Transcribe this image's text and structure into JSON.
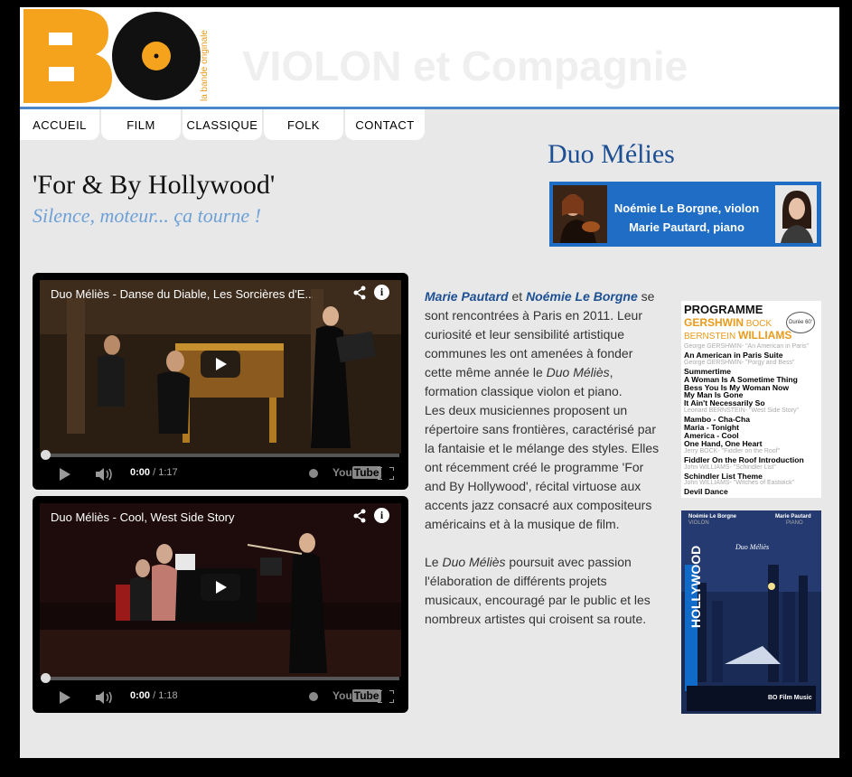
{
  "logo": {
    "tagline": "la bande originale"
  },
  "site_title": "VIOLON et Compagnie",
  "nav": [
    "ACCUEIL",
    "FILM",
    "CLASSIQUE",
    "FOLK",
    "CONTACT"
  ],
  "heading": "'For & By Hollywood'",
  "subheading": "Silence, moteur... ça tourne !",
  "duo": {
    "title": "Duo Mélies",
    "line1": "Noémie Le Borgne, violon",
    "line2": "Marie Pautard, piano"
  },
  "videos": [
    {
      "title": "Duo Méliès - Danse du Diable, Les Sorcières d'E...",
      "time_current": "0:00",
      "time_total": "/ 1:17"
    },
    {
      "title": "Duo Méliès - Cool, West Side Story",
      "time_current": "0:00",
      "time_total": "/ 1:18"
    }
  ],
  "bio": {
    "name1": "Marie Pautard",
    "and": " et ",
    "name2": "Noémie Le Borgne",
    "p1_rest": " se sont rencontrées à Paris en 2011. Leur curiosité et leur sensibilité artistique communes les ont amenées à fonder cette même année le ",
    "duo_name": "Duo Méliès",
    "p1_end": ", formation classique violon et piano.",
    "p2": "Les deux musiciennes proposent un répertoire sans frontières, caractérisé par la fantaisie et le mélange des styles. Elles ont récemment créé le programme 'For and By Hollywood', récital virtuose aux accents jazz consacré aux compositeurs américains et à la musique de film.",
    "p3_start": "Le ",
    "p3_duo": "Duo Méliès",
    "p3_rest": " poursuit avec passion l'élaboration de différents projets musicaux, encouragé par le public et les nombreux artistes qui croisent sa route."
  },
  "programme": {
    "title": "PROGRAMME",
    "comp1a": "GERSHWIN",
    "comp1b": "BOCK",
    "comp2a": "BERNSTEIN",
    "comp2b": "WILLIAMS",
    "badge": "Durée 60'",
    "items": [
      {
        "kind": "c",
        "text": "George GERSHWIN- \"An American in Paris\""
      },
      {
        "kind": "w",
        "text": "An American in Paris Suite"
      },
      {
        "kind": "c",
        "text": "George GERSHWIN- \"Porgy and Bess\""
      },
      {
        "kind": "w",
        "text": "Summertime"
      },
      {
        "kind": "w",
        "text": "A Woman Is A Sometime Thing"
      },
      {
        "kind": "w",
        "text": "Bess You Is My Woman Now"
      },
      {
        "kind": "w",
        "text": "My Man Is Gone"
      },
      {
        "kind": "w",
        "text": "It Ain't Necessarily So"
      },
      {
        "kind": "c",
        "text": "Leonard BERNSTEIN- \"West Side Story\""
      },
      {
        "kind": "w",
        "text": "Mambo - Cha-Cha"
      },
      {
        "kind": "w",
        "text": "Maria - Tonight"
      },
      {
        "kind": "w",
        "text": "America - Cool"
      },
      {
        "kind": "w",
        "text": "One Hand, One Heart"
      },
      {
        "kind": "c",
        "text": "Jerry BOCK- \"Fiddler on the Roof\""
      },
      {
        "kind": "w",
        "text": "Fiddler On the Roof Introduction"
      },
      {
        "kind": "c",
        "text": "John WILLIAMS- \"Schindler List\""
      },
      {
        "kind": "w",
        "text": "Schindler List Theme"
      },
      {
        "kind": "c",
        "text": "John WILLIAMS- \"Witches of Eastwick\""
      },
      {
        "kind": "w",
        "text": "Devil Dance"
      }
    ]
  },
  "poster": {
    "violin_name": "Noémie Le Borgne",
    "violin_label": "VIOLON",
    "piano_name": "Marie Pautard",
    "piano_label": "PIANO",
    "logo_text": "Duo Méliès",
    "hollywood": "HOLLYWOOD",
    "footer": "BO Film Music"
  },
  "colors": {
    "accent_blue": "#1d4f93",
    "banner_blue": "#1f6dc4",
    "logo_orange": "#f5a21c",
    "subheading": "#6ea0d8"
  }
}
